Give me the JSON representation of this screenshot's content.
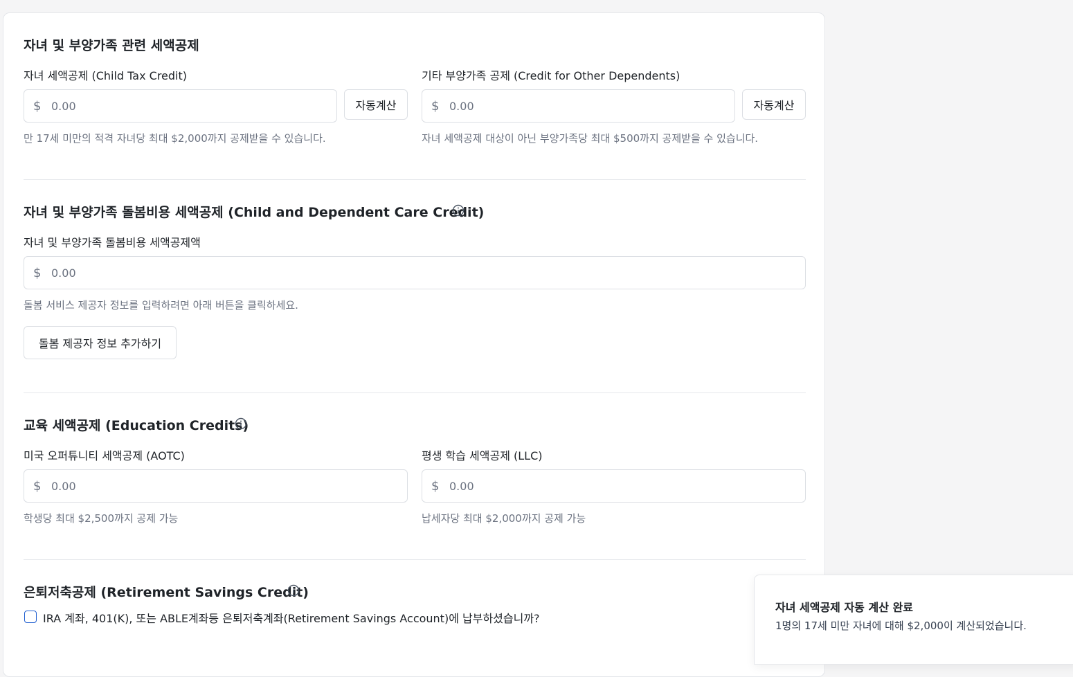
{
  "sections": {
    "children": {
      "title": "자녀 및 부양가족 관련 세액공제",
      "ctc": {
        "label": "자녀 세액공제 (Child Tax Credit)",
        "currency": "$",
        "placeholder": "0.00",
        "button": "자동계산",
        "help": "만 17세 미만의 적격 자녀당 최대 $2,000까지 공제받을 수 있습니다."
      },
      "odc": {
        "label": "기타 부양가족 공제 (Credit for Other Dependents)",
        "currency": "$",
        "placeholder": "0.00",
        "button": "자동계산",
        "help": "자녀 세액공제 대상이 아닌 부양가족당 최대 $500까지 공제받을 수 있습니다."
      }
    },
    "care": {
      "title": "자녀 및 부양가족 돌봄비용 세액공제 (Child and Dependent Care Credit)",
      "label": "자녀 및 부양가족 돌봄비용 세액공제액",
      "currency": "$",
      "placeholder": "0.00",
      "help": "돌봄 서비스 제공자 정보를 입력하려면 아래 버튼을 클릭하세요.",
      "button": "돌봄 제공자 정보 추가하기"
    },
    "education": {
      "title": "교육 세액공제 (Education Credits)",
      "aotc": {
        "label": "미국 오퍼튜니티 세액공제 (AOTC)",
        "currency": "$",
        "placeholder": "0.00",
        "help": "학생당 최대 $2,500까지 공제 가능"
      },
      "llc": {
        "label": "평생 학습 세액공제 (LLC)",
        "currency": "$",
        "placeholder": "0.00",
        "help": "납세자당 최대 $2,000까지 공제 가능"
      }
    },
    "retirement": {
      "title": "은퇴저축공제 (Retirement Savings Credit)",
      "checkbox_label": "IRA 계좌, 401(K), 또는 ABLE계좌등 은퇴저축계좌(Retirement Savings Account)에 납부하셨습니까?",
      "checked": false
    }
  },
  "toast": {
    "title": "자녀 세액공제 자동 계산 완료",
    "message": "1명의 17세 미만 자녀에 대해 $2,000이 계산되었습니다."
  },
  "colors": {
    "accent": "#1f5fd0",
    "border": "#dcdfe4",
    "muted": "#6b7280",
    "background": "#f5f5f6"
  }
}
